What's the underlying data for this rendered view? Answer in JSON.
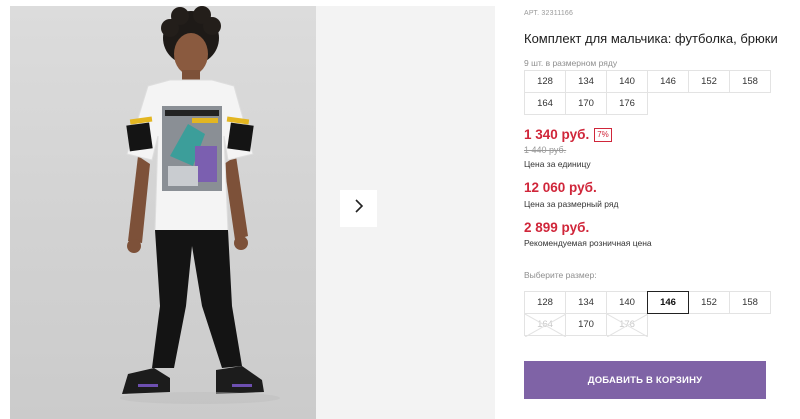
{
  "product": {
    "article": "АРТ. 32311166",
    "title": "Комплект для мальчика: футболка, брюки",
    "row_count": "9 шт. в размерном ряду"
  },
  "size_row": [
    "128",
    "134",
    "140",
    "146",
    "152",
    "158",
    "164",
    "170",
    "176"
  ],
  "prices": {
    "current": "1 340 руб.",
    "discount": "7%",
    "old": "1 440 руб.",
    "unit_label": "Цена за единицу",
    "row_price": "12 060 руб.",
    "row_label": "Цена за размерный ряд",
    "retail_price": "2 899 руб.",
    "retail_label": "Рекомендуемая розничная цена"
  },
  "size_picker": {
    "label": "Выберите размер:",
    "options": [
      {
        "label": "128",
        "state": "available"
      },
      {
        "label": "134",
        "state": "available"
      },
      {
        "label": "140",
        "state": "available"
      },
      {
        "label": "146",
        "state": "selected"
      },
      {
        "label": "152",
        "state": "available"
      },
      {
        "label": "158",
        "state": "available"
      },
      {
        "label": "164",
        "state": "unavailable"
      },
      {
        "label": "170",
        "state": "available"
      },
      {
        "label": "176",
        "state": "unavailable"
      }
    ]
  },
  "cart_button": "ДОБАВИТЬ В КОРЗИНУ",
  "icons": {
    "next": "chevron-right-icon"
  },
  "colors": {
    "accent": "#7f63a6",
    "price": "#d0263a"
  }
}
